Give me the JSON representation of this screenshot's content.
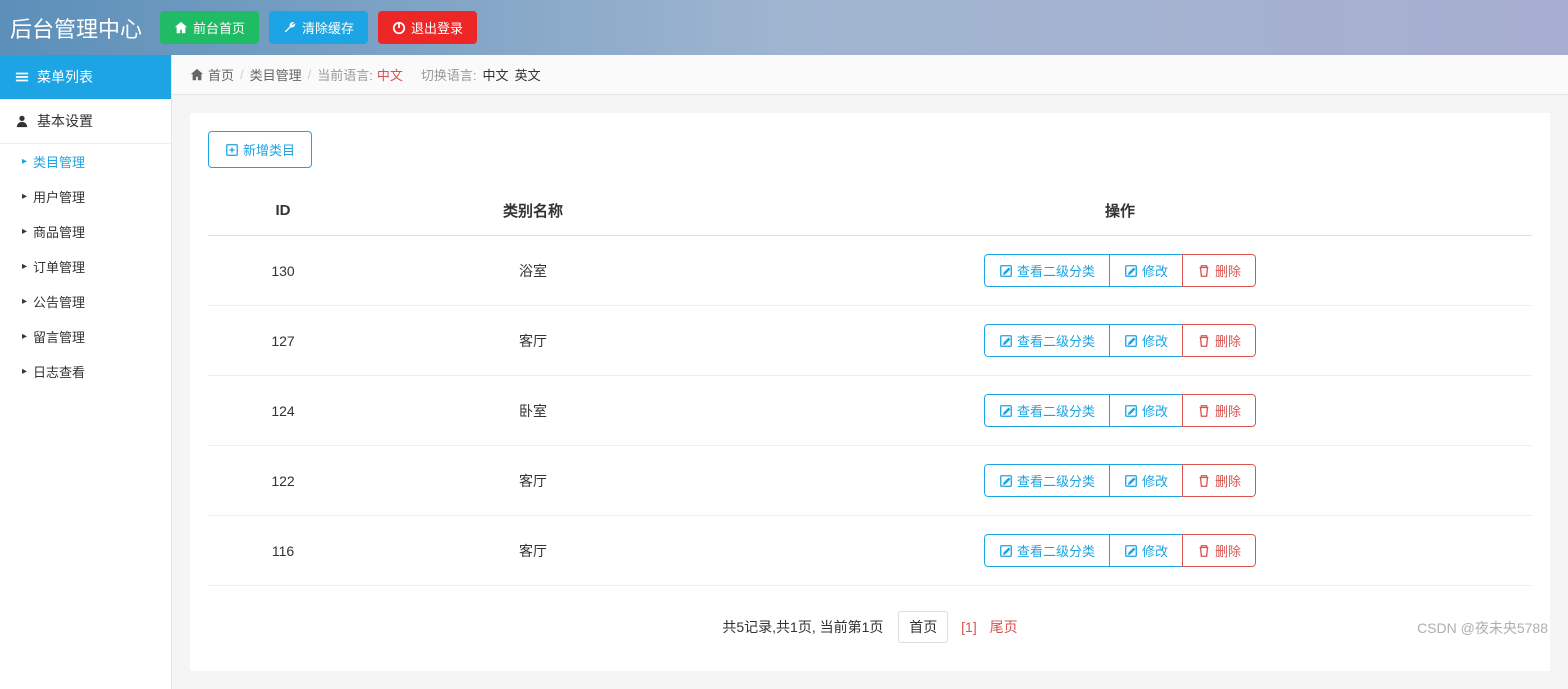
{
  "header": {
    "title": "后台管理中心",
    "buttons": {
      "frontend": "前台首页",
      "clear_cache": "清除缓存",
      "logout": "退出登录"
    }
  },
  "sidebar": {
    "menu_header": "菜单列表",
    "section": "基本设置",
    "items": [
      {
        "label": "类目管理",
        "active": true
      },
      {
        "label": "用户管理",
        "active": false
      },
      {
        "label": "商品管理",
        "active": false
      },
      {
        "label": "订单管理",
        "active": false
      },
      {
        "label": "公告管理",
        "active": false
      },
      {
        "label": "留言管理",
        "active": false
      },
      {
        "label": "日志查看",
        "active": false
      }
    ]
  },
  "breadcrumb": {
    "home": "首页",
    "current": "类目管理",
    "lang_label": "当前语言:",
    "lang_value": "中文",
    "switch_label": "切换语言:",
    "lang_zh": "中文",
    "lang_en": "英文"
  },
  "content": {
    "add_button": "新增类目",
    "table": {
      "headers": {
        "id": "ID",
        "name": "类别名称",
        "ops": "操作"
      },
      "rows": [
        {
          "id": "130",
          "name": "浴室"
        },
        {
          "id": "127",
          "name": "客厅"
        },
        {
          "id": "124",
          "name": "卧室"
        },
        {
          "id": "122",
          "name": "客厅"
        },
        {
          "id": "116",
          "name": "客厅"
        }
      ],
      "ops": {
        "view": "查看二级分类",
        "edit": "修改",
        "delete": "删除"
      }
    },
    "pagination": {
      "info": "共5记录,共1页, 当前第1页",
      "first": "首页",
      "current": "[1]",
      "last": "尾页"
    }
  },
  "watermark": "CSDN @夜未央5788"
}
